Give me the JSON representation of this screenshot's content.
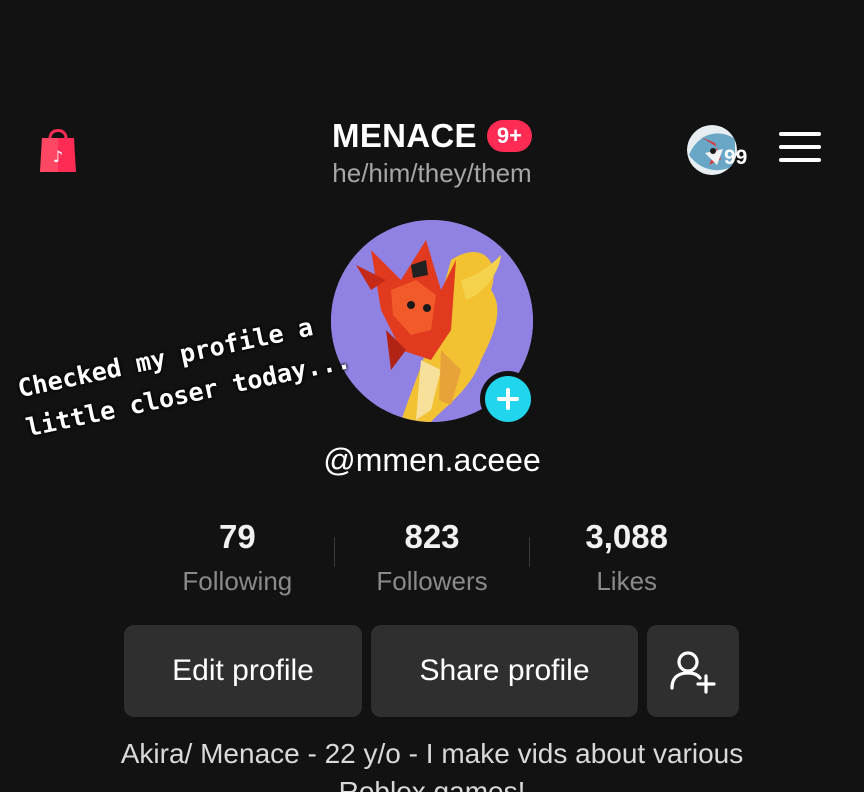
{
  "header": {
    "title": "MENACE",
    "notification_badge": "9+",
    "pronouns": "he/him/they/them",
    "mini_avatar_count": "99"
  },
  "profile": {
    "handle": "@mmen.aceee"
  },
  "caption": {
    "line1": "Checked my profile a",
    "line2": "little closer today..."
  },
  "stats": [
    {
      "value": "79",
      "label": "Following"
    },
    {
      "value": "823",
      "label": "Followers"
    },
    {
      "value": "3,088",
      "label": "Likes"
    }
  ],
  "buttons": {
    "edit": "Edit profile",
    "share": "Share profile"
  },
  "bio": {
    "line1": "Akira/ Menace - 22 y/o - I make vids about various",
    "line2": "Roblox games!"
  },
  "colors": {
    "background": "#121212",
    "badge": "#fe2c55",
    "add_button": "#20d5ec",
    "shop_icon": "#fe2c55",
    "button_bg": "#2f2f2f"
  }
}
